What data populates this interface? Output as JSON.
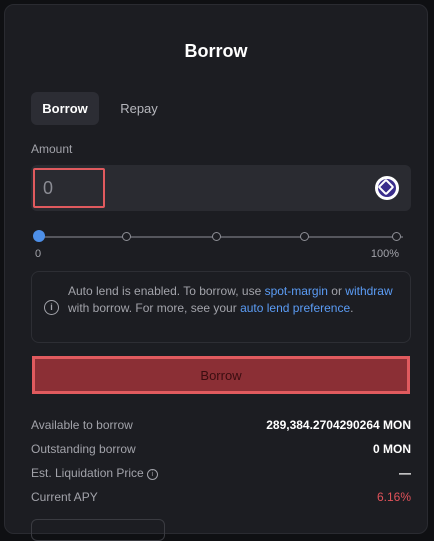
{
  "title": "Borrow",
  "tabs": [
    {
      "label": "Borrow",
      "active": true
    },
    {
      "label": "Repay",
      "active": false
    }
  ],
  "amount": {
    "label": "Amount",
    "value": "0",
    "token_icon": "monad-token-icon"
  },
  "slider": {
    "min_label": "0",
    "max_label": "100%",
    "value_percent": 0
  },
  "notice": {
    "icon": "info-icon",
    "text_1": "Auto lend is enabled. To borrow, use ",
    "link_1": "spot-margin",
    "text_2": " or ",
    "link_2": "withdraw",
    "text_3": " with borrow. For more, see your ",
    "link_3": "auto lend preference",
    "text_4": "."
  },
  "borrow_button": "Borrow",
  "details": [
    {
      "label": "Available to borrow",
      "value": "289,384.2704290264 MON"
    },
    {
      "label": "Outstanding borrow",
      "value": "0 MON"
    },
    {
      "label": "Est. Liquidation Price",
      "value": "—"
    },
    {
      "label": "Current APY",
      "value": "6.16%"
    }
  ],
  "colors": {
    "accent_blue": "#5b9cf5",
    "highlight_red": "#e05a5e",
    "apy_red": "#e0525a"
  }
}
